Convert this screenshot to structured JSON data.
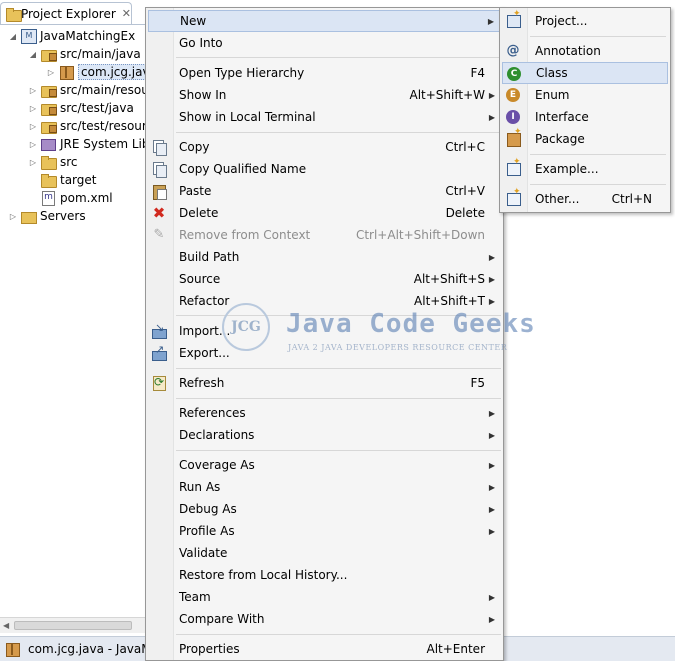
{
  "explorer": {
    "tab_title": "Project Explorer",
    "tab_close": "✕",
    "tree": [
      {
        "label": "JavaMatchingEx",
        "icon": "maven-project-icon",
        "expanded": true
      },
      {
        "label": "src/main/java",
        "icon": "source-folder-icon",
        "expanded": true
      },
      {
        "label": "com.jcg.java",
        "icon": "package-icon",
        "expanded": false
      },
      {
        "label": "src/main/resources",
        "icon": "source-folder-icon",
        "expanded": false
      },
      {
        "label": "src/test/java",
        "icon": "source-folder-icon",
        "expanded": false
      },
      {
        "label": "src/test/resources",
        "icon": "source-folder-icon",
        "expanded": false
      },
      {
        "label": "JRE System Library",
        "icon": "library-icon",
        "expanded": false
      },
      {
        "label": "src",
        "icon": "folder-icon",
        "expanded": false
      },
      {
        "label": "target",
        "icon": "folder-icon"
      },
      {
        "label": "pom.xml",
        "icon": "pom-file-icon"
      },
      {
        "label": "Servers",
        "icon": "folder-icon",
        "expanded": false
      }
    ]
  },
  "status_bar": {
    "text": "com.jcg.java - JavaMatchingEx"
  },
  "context_menu": {
    "items": [
      {
        "label": "New",
        "shortcut": "",
        "submenu": true
      },
      {
        "label": "Go Into",
        "shortcut": ""
      },
      {
        "label": "Open Type Hierarchy",
        "shortcut": "F4"
      },
      {
        "label": "Show In",
        "shortcut": "Alt+Shift+W",
        "submenu": true
      },
      {
        "label": "Show in Local Terminal",
        "shortcut": "",
        "submenu": true
      },
      {
        "label": "Copy",
        "shortcut": "Ctrl+C",
        "icon": "copy-icon"
      },
      {
        "label": "Copy Qualified Name",
        "shortcut": "",
        "icon": "copy-icon"
      },
      {
        "label": "Paste",
        "shortcut": "Ctrl+V",
        "icon": "paste-icon"
      },
      {
        "label": "Delete",
        "shortcut": "Delete",
        "icon": "delete-icon"
      },
      {
        "label": "Remove from Context",
        "shortcut": "Ctrl+Alt+Shift+Down",
        "disabled": true,
        "icon": "remove-context-icon"
      },
      {
        "label": "Build Path",
        "shortcut": "",
        "submenu": true
      },
      {
        "label": "Source",
        "shortcut": "Alt+Shift+S",
        "submenu": true
      },
      {
        "label": "Refactor",
        "shortcut": "Alt+Shift+T",
        "submenu": true
      },
      {
        "label": "Import...",
        "shortcut": "",
        "icon": "import-icon"
      },
      {
        "label": "Export...",
        "shortcut": "",
        "icon": "export-icon"
      },
      {
        "label": "Refresh",
        "shortcut": "F5",
        "icon": "refresh-icon"
      },
      {
        "label": "References",
        "shortcut": "",
        "submenu": true
      },
      {
        "label": "Declarations",
        "shortcut": "",
        "submenu": true
      },
      {
        "label": "Coverage As",
        "shortcut": "",
        "submenu": true
      },
      {
        "label": "Run As",
        "shortcut": "",
        "submenu": true
      },
      {
        "label": "Debug As",
        "shortcut": "",
        "submenu": true
      },
      {
        "label": "Profile As",
        "shortcut": "",
        "submenu": true
      },
      {
        "label": "Validate",
        "shortcut": ""
      },
      {
        "label": "Restore from Local History...",
        "shortcut": ""
      },
      {
        "label": "Team",
        "shortcut": "",
        "submenu": true
      },
      {
        "label": "Compare With",
        "shortcut": "",
        "submenu": true
      },
      {
        "label": "Properties",
        "shortcut": "Alt+Enter"
      }
    ]
  },
  "new_submenu": {
    "items": [
      {
        "label": "Project...",
        "shortcut": "",
        "icon": "new-project-icon"
      },
      {
        "label": "Annotation",
        "shortcut": "",
        "icon": "annotation-icon"
      },
      {
        "label": "Class",
        "shortcut": "",
        "icon": "class-icon",
        "highlighted": true
      },
      {
        "label": "Enum",
        "shortcut": "",
        "icon": "enum-icon"
      },
      {
        "label": "Interface",
        "shortcut": "",
        "icon": "interface-icon"
      },
      {
        "label": "Package",
        "shortcut": "",
        "icon": "new-package-icon"
      },
      {
        "label": "Example...",
        "shortcut": "",
        "icon": "example-icon"
      },
      {
        "label": "Other...",
        "shortcut": "Ctrl+N",
        "icon": "other-wizard-icon"
      }
    ]
  },
  "watermark": {
    "logo_text": "JCG",
    "title": "Java Code Geeks",
    "subtitle": "JAVA 2 JAVA DEVELOPERS RESOURCE CENTER"
  },
  "colors": {
    "menu_background": "#f5f5f5",
    "menu_hover": "#dbe5f4",
    "disabled_text": "#8d8d8d",
    "status_bar": "#e4e9f1"
  }
}
